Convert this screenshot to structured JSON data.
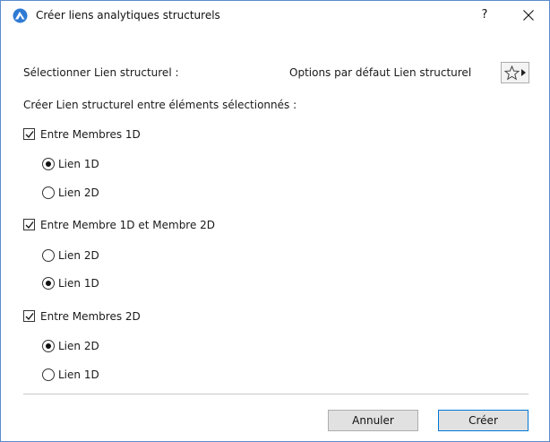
{
  "window": {
    "title": "Créer liens analytiques structurels",
    "help_label": "?",
    "app_icon": "archicad-app-icon",
    "close_icon": "close-icon"
  },
  "header": {
    "select_label": "Sélectionner Lien structurel :",
    "defaults_label": "Options par défaut Lien structurel",
    "favorites_icon": "star-icon"
  },
  "section_label": "Créer Lien structurel entre éléments sélectionnés :",
  "groups": [
    {
      "label": "Entre Membres 1D",
      "checked": true,
      "options": [
        {
          "label": "Lien 1D",
          "selected": true
        },
        {
          "label": "Lien 2D",
          "selected": false
        }
      ]
    },
    {
      "label": "Entre Membre 1D et Membre 2D",
      "checked": true,
      "options": [
        {
          "label": "Lien 2D",
          "selected": false
        },
        {
          "label": "Lien 1D",
          "selected": true
        }
      ]
    },
    {
      "label": "Entre Membres 2D",
      "checked": true,
      "options": [
        {
          "label": "Lien 2D",
          "selected": true
        },
        {
          "label": "Lien 1D",
          "selected": false
        }
      ]
    }
  ],
  "buttons": {
    "cancel_label": "Annuler",
    "create_label": "Créer"
  },
  "colors": {
    "window_border": "#5b8ccc",
    "primary_button_border": "#0078d7",
    "app_icon_blue": "#2f7bd4"
  }
}
